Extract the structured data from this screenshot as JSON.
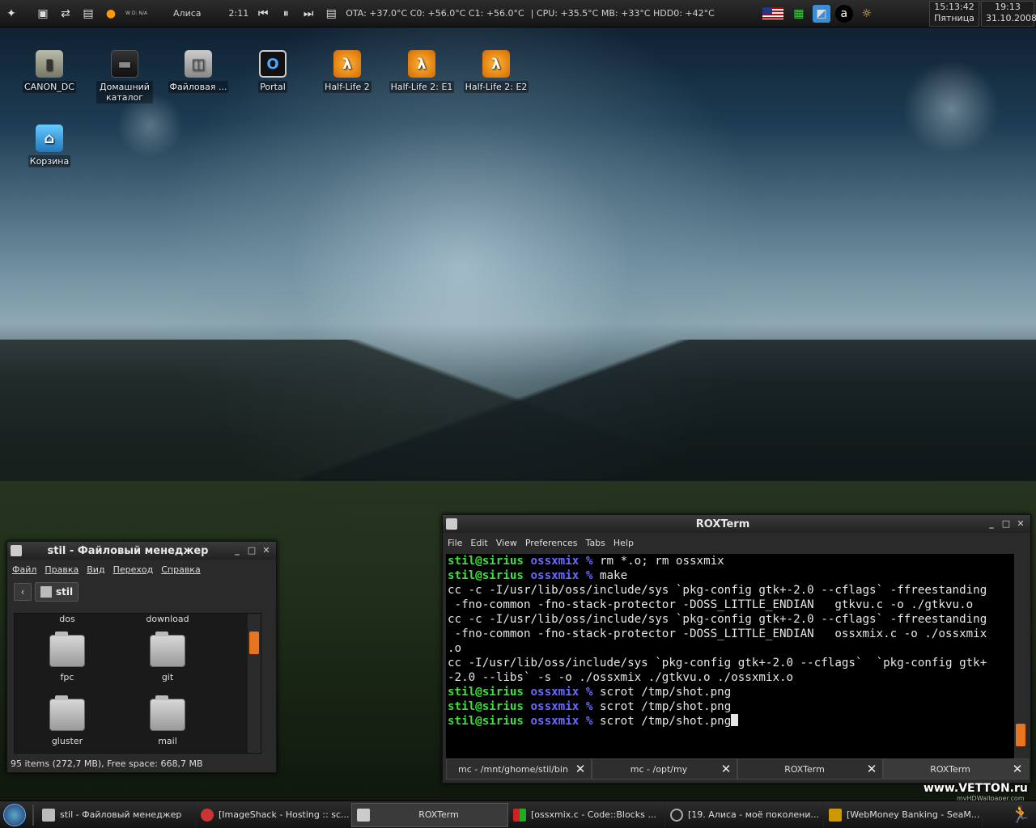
{
  "top_panel": {
    "weather": "W D: N/A",
    "user": "Алиса",
    "track_time": "2:11",
    "sensors": "OTA: +37.0°C C0: +56.0°C C1: +56.0°C",
    "sensors2": "| CPU: +35.5°C MB: +33°C HDD0: +42°C",
    "clock_time": "15:13:42",
    "clock_day": "Пятница",
    "clock2_time": "19:13",
    "clock2_date": "31.10.2008"
  },
  "desktop_icons": [
    {
      "label": "CANON_DC"
    },
    {
      "label": "Домашний каталог"
    },
    {
      "label": "Файловая ..."
    },
    {
      "label": "Portal"
    },
    {
      "label": "Half-Life 2"
    },
    {
      "label": "Half-Life 2: E1"
    },
    {
      "label": "Half-Life 2: E2"
    },
    {
      "label": "Корзина"
    }
  ],
  "file_manager": {
    "title": "stil - Файловый менеджер",
    "menu": [
      "Файл",
      "Правка",
      "Вид",
      "Переход",
      "Справка"
    ],
    "path": "stil",
    "items": [
      {
        "name": "dos"
      },
      {
        "name": "download"
      },
      {
        "name": "fpc"
      },
      {
        "name": "git"
      },
      {
        "name": "gluster"
      },
      {
        "name": "mail"
      }
    ],
    "status": "95 items (272,7 MB), Free space: 668,7 MB"
  },
  "terminal": {
    "title": "ROXTerm",
    "menu": [
      "File",
      "Edit",
      "View",
      "Preferences",
      "Tabs",
      "Help"
    ],
    "prompt_user": "stil@sirius",
    "prompt_dir": "ossxmix",
    "prompt_sign": "%",
    "lines": {
      "l1_cmd": " rm *.o; rm ossxmix",
      "l2_cmd": " make",
      "l3": "cc -c -I/usr/lib/oss/include/sys `pkg-config gtk+-2.0 --cflags` -ffreestanding",
      "l4": " -fno-common -fno-stack-protector -DOSS_LITTLE_ENDIAN   gtkvu.c -o ./gtkvu.o",
      "l5": "cc -c -I/usr/lib/oss/include/sys `pkg-config gtk+-2.0 --cflags` -ffreestanding",
      "l6": " -fno-common -fno-stack-protector -DOSS_LITTLE_ENDIAN   ossxmix.c -o ./ossxmix",
      "l7": ".o",
      "l8": "cc -I/usr/lib/oss/include/sys `pkg-config gtk+-2.0 --cflags`  `pkg-config gtk+",
      "l9": "-2.0 --libs` -s -o ./ossxmix ./gtkvu.o ./ossxmix.o",
      "l10_cmd": " scrot /tmp/shot.png",
      "l11_cmd": " scrot /tmp/shot.png",
      "l12_cmd": " scrot /tmp/shot.png"
    },
    "tabs": [
      {
        "label": "mc - /mnt/ghome/stil/bin"
      },
      {
        "label": "mc - /opt/my"
      },
      {
        "label": "ROXTerm"
      },
      {
        "label": "ROXTerm"
      }
    ]
  },
  "watermark": {
    "main": "www.VETTON.ru",
    "sub": "myHDWallpaper.com"
  },
  "taskbar": {
    "tasks": [
      {
        "label": "stil - Файловый менеджер"
      },
      {
        "label": "[ImageShack - Hosting :: sc..."
      },
      {
        "label": "ROXTerm"
      },
      {
        "label": "[ossxmix.c - Code::Blocks ..."
      },
      {
        "label": "[19. Алиса - моё поколени..."
      },
      {
        "label": "[WebMoney Banking - SeaM..."
      }
    ]
  },
  "colors": {
    "prompt_green": "#3ce03c",
    "prompt_blue": "#6a6aff",
    "scroll_thumb": "#e87420"
  }
}
